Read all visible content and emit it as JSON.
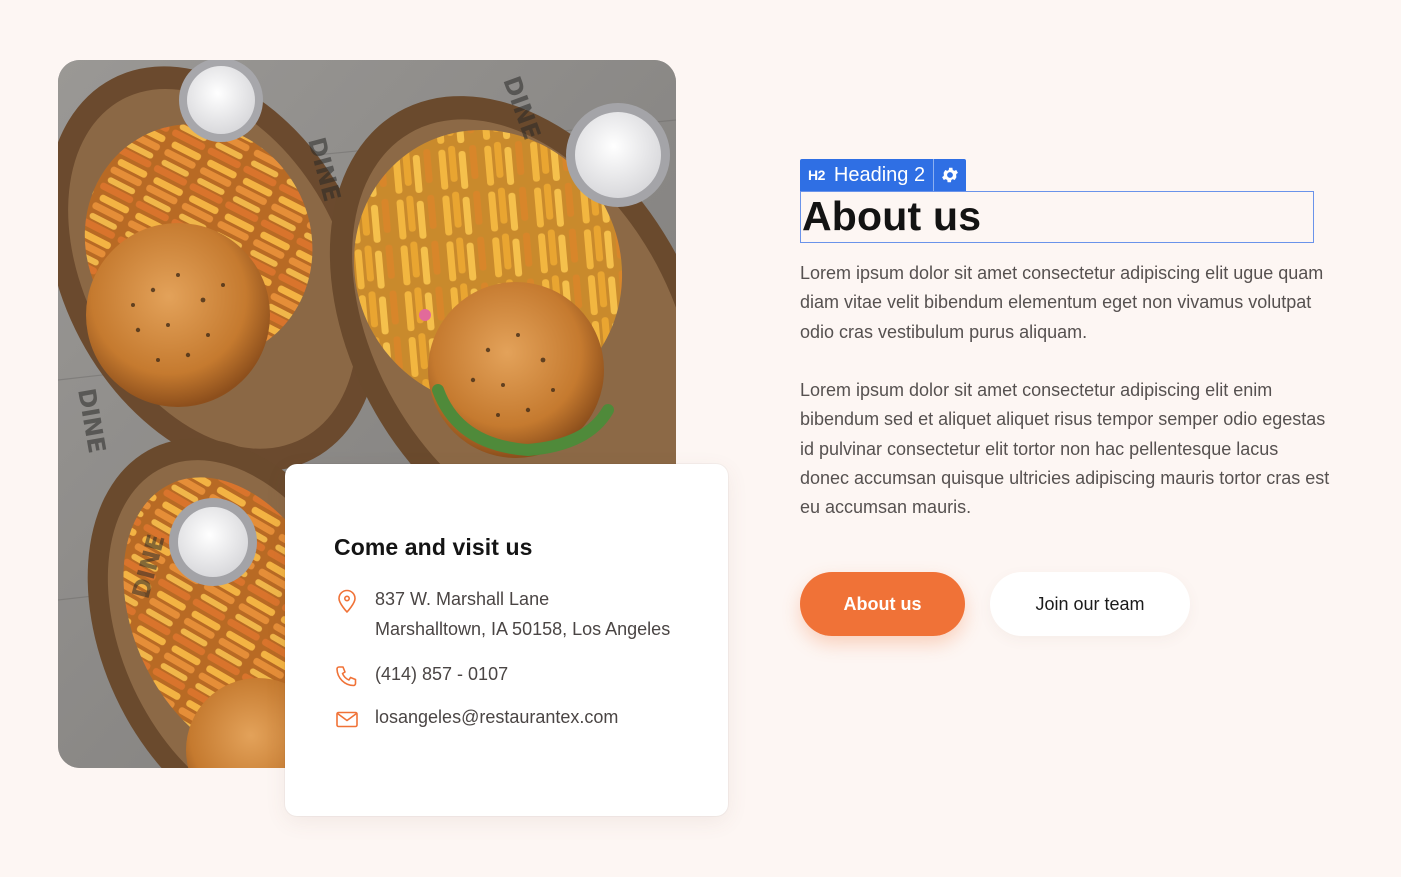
{
  "image": {
    "alt": "Burgers and fries in paper-lined baskets with dipping sauce"
  },
  "visit": {
    "title": "Come and visit us",
    "address_line1": "837 W. Marshall Lane",
    "address_line2": "Marshalltown, IA 50158, Los Angeles",
    "phone": "(414) 857 - 0107",
    "email": "losangeles@restaurantex.com",
    "icons": [
      "location-pin-icon",
      "phone-icon",
      "mail-icon"
    ]
  },
  "editor": {
    "tag_label": "H2",
    "widget_label": "Heading 2",
    "settings_icon": "gear-icon"
  },
  "about": {
    "heading": "About us",
    "paragraph1": "Lorem ipsum dolor sit amet consectetur adipiscing elit ugue quam diam vitae velit bibendum elementum eget non vivamus volutpat odio cras vestibulum purus aliquam.",
    "paragraph2": "Lorem ipsum dolor sit amet consectetur adipiscing elit enim bibendum sed et aliquet aliquet risus tempor semper odio egestas id pulvinar consectetur elit tortor non hac pellentesque lacus donec accumsan quisque ultricies adipiscing mauris tortor cras est eu accumsan mauris."
  },
  "buttons": {
    "primary": "About us",
    "secondary": "Join our team"
  },
  "colors": {
    "background": "#fdf6f3",
    "accent": "#f07237",
    "editor_blue": "#2f6fe4",
    "heading": "#131313",
    "body_text": "#565150"
  }
}
